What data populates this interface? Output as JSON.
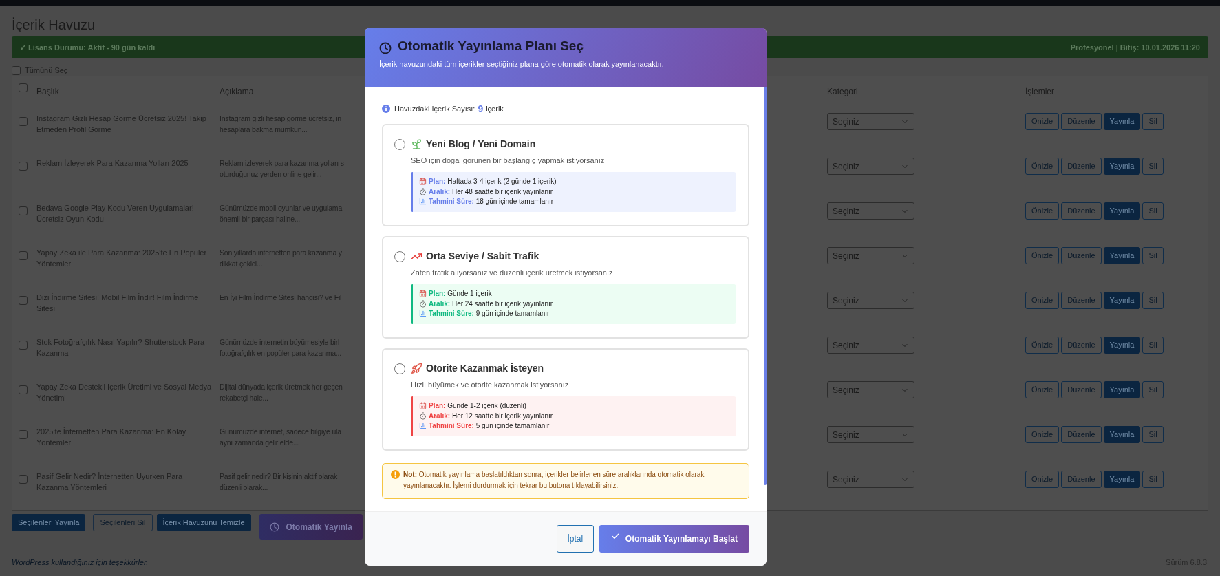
{
  "page": {
    "title": "İçerik Havuzu",
    "license": {
      "status": "✓ Lisans Durumu: Aktif - 90 gün kaldı",
      "plan": "Profesyonel | Bitiş: 10.01.2026 11:20"
    },
    "select_all": {
      "label": "Tümünü Seç",
      "checked": false
    },
    "table": {
      "columns": [
        "Başlık",
        "Açıklama",
        "Kategori",
        "İşlemler"
      ],
      "header_checked": false,
      "rows": [
        {
          "checked": false,
          "title": "Instagram Gizli Hesap Görme Ücretsiz 2025! Takip Etmeden Profil Görme",
          "description_lines": [
            "Instagram gizli hesap görme ücretsiz, in",
            "hesaplara bakma mümkün..."
          ],
          "category": "Seçiniz",
          "actions": [
            {
              "label": "Önizle",
              "kind": "outline"
            },
            {
              "label": "Düzenle",
              "kind": "outline"
            },
            {
              "label": "Yayınla",
              "kind": "primary"
            },
            {
              "label": "Sil",
              "kind": "outline"
            }
          ]
        },
        {
          "checked": false,
          "title": "Reklam İzleyerek Para Kazanma Yolları 2025",
          "description_lines": [
            "Reklam izleyerek para kazanma yolları s",
            "oturduğunuz yerden online gelir..."
          ],
          "category": "Seçiniz",
          "actions": [
            {
              "label": "Önizle",
              "kind": "outline"
            },
            {
              "label": "Düzenle",
              "kind": "outline"
            },
            {
              "label": "Yayınla",
              "kind": "primary"
            },
            {
              "label": "Sil",
              "kind": "outline"
            }
          ]
        },
        {
          "checked": false,
          "title": "Bedava Google Play Kodu Veren Uygulamalar! Ücretsiz Oyun Kodu",
          "description_lines": [
            "Günümüzde mobil oyunlar ve uygulama",
            "önemli bir parçası haline..."
          ],
          "category": "Seçiniz",
          "actions": [
            {
              "label": "Önizle",
              "kind": "outline"
            },
            {
              "label": "Düzenle",
              "kind": "outline"
            },
            {
              "label": "Yayınla",
              "kind": "primary"
            },
            {
              "label": "Sil",
              "kind": "outline"
            }
          ]
        },
        {
          "checked": false,
          "title": "Yapay Zeka ile Para Kazanma: 2025'te En Popüler Yöntemler",
          "description_lines": [
            "Son yıllarda internetten para kazanma y",
            "dikkat çekici..."
          ],
          "category": "Seçiniz",
          "actions": [
            {
              "label": "Önizle",
              "kind": "outline"
            },
            {
              "label": "Düzenle",
              "kind": "outline"
            },
            {
              "label": "Yayınla",
              "kind": "primary"
            },
            {
              "label": "Sil",
              "kind": "outline"
            }
          ]
        },
        {
          "checked": false,
          "title": "Dizi İndirme Sitesi! Mobil Film İndir! Film İndirme Sitesi",
          "description_lines": [
            "En İyi Film İndirme Sitesi hangisi? ve Fil"
          ],
          "category": "Seçiniz",
          "actions": [
            {
              "label": "Önizle",
              "kind": "outline"
            },
            {
              "label": "Düzenle",
              "kind": "outline"
            },
            {
              "label": "Yayınla",
              "kind": "primary"
            },
            {
              "label": "Sil",
              "kind": "outline"
            }
          ]
        },
        {
          "checked": false,
          "title": "Stok Fotoğrafçılık Nasıl Yapılır? Shutterstock Para Kazanma",
          "description_lines": [
            "Günümüzde internetin büyümesiyle birl",
            "fotoğrafçılık en popüler para kazanma..."
          ],
          "category": "Seçiniz",
          "actions": [
            {
              "label": "Önizle",
              "kind": "outline"
            },
            {
              "label": "Düzenle",
              "kind": "outline"
            },
            {
              "label": "Yayınla",
              "kind": "primary"
            },
            {
              "label": "Sil",
              "kind": "outline"
            }
          ]
        },
        {
          "checked": false,
          "title": "Yapay Zeka Destekli İçerik Üretimi ve Sosyal Medya Yönetimi",
          "description_lines": [
            "Dijital dünyada içerik üretmek her geçen",
            "rekabetçi hale..."
          ],
          "category": "Seçiniz",
          "actions": [
            {
              "label": "Önizle",
              "kind": "outline"
            },
            {
              "label": "Düzenle",
              "kind": "outline"
            },
            {
              "label": "Yayınla",
              "kind": "primary"
            },
            {
              "label": "Sil",
              "kind": "outline"
            }
          ]
        },
        {
          "checked": false,
          "title": "2025'te İnternetten Para Kazanma: En Kolay Yöntemler",
          "description_lines": [
            "Günümüzde internet, sadece bilgiye ula",
            "aynı zamanda gelir elde..."
          ],
          "category": "Seçiniz",
          "actions": [
            {
              "label": "Önizle",
              "kind": "outline"
            },
            {
              "label": "Düzenle",
              "kind": "outline"
            },
            {
              "label": "Yayınla",
              "kind": "primary"
            },
            {
              "label": "Sil",
              "kind": "outline"
            }
          ]
        },
        {
          "checked": false,
          "title": "Pasif Gelir Nedir? İnternetten Uyurken Para Kazanma Yöntemleri",
          "description_lines": [
            "Pasif gelir nedir? Bir kişinin aktif olarak",
            "düzenli olarak..."
          ],
          "category": "Seçiniz",
          "actions": [
            {
              "label": "Önizle",
              "kind": "outline"
            },
            {
              "label": "Düzenle",
              "kind": "outline"
            },
            {
              "label": "Yayınla",
              "kind": "primary"
            },
            {
              "label": "Sil",
              "kind": "outline"
            }
          ]
        }
      ]
    },
    "bulk_buttons": [
      {
        "label": "Seçilenleri Yayınla",
        "kind": "primary"
      },
      {
        "label": "Seçilenleri Sil",
        "kind": "outline"
      },
      {
        "label": "İçerik Havuzunu Temizle",
        "kind": "primary"
      },
      {
        "label": "Otomatik Yayınla",
        "kind": "auto"
      }
    ],
    "footer": {
      "thanks": "WordPress kullandığınız için teşekkürler.",
      "version": "Sürüm 6.8.3"
    }
  },
  "modal": {
    "title": "Otomatik Yayınlama Planı Seç",
    "subtitle": "İçerik havuzundaki tüm içerikler seçtiğiniz plana göre otomatik olarak yayınlanacaktır.",
    "pool_count": {
      "label": "Havuzdaki İçerik Sayısı:",
      "value": "9",
      "unit": "içerik"
    },
    "plans": [
      {
        "kind": "blog",
        "selected": false,
        "color": "#667eea",
        "title": "Yeni Blog / Yeni Domain",
        "description": "SEO için doğal görünen bir başlangıç yapmak istiyorsanız",
        "details": [
          {
            "kind": "plan",
            "label": "Plan:",
            "value": "Haftada 3-4 içerik (2 günde 1 içerik)"
          },
          {
            "kind": "interval",
            "label": "Aralık:",
            "value": "Her 48 saatte bir içerik yayınlanır"
          },
          {
            "kind": "duration",
            "label": "Tahmini Süre:",
            "value": "18 gün içinde tamamlanır"
          }
        ]
      },
      {
        "kind": "traffic",
        "selected": false,
        "color": "#10b981",
        "title": "Orta Seviye / Sabit Trafik",
        "description": "Zaten trafik alıyorsanız ve düzenli içerik üretmek istiyorsanız",
        "details": [
          {
            "kind": "plan",
            "label": "Plan:",
            "value": "Günde 1 içerik"
          },
          {
            "kind": "interval",
            "label": "Aralık:",
            "value": "Her 24 saatte bir içerik yayınlanır"
          },
          {
            "kind": "duration",
            "label": "Tahmini Süre:",
            "value": "9 gün içinde tamamlanır"
          }
        ]
      },
      {
        "kind": "authority",
        "selected": false,
        "color": "#ef4444",
        "title": "Otorite Kazanmak İsteyen",
        "description": "Hızlı büyümek ve otorite kazanmak istiyorsanız",
        "details": [
          {
            "kind": "plan",
            "label": "Plan:",
            "value": "Günde 1-2 içerik (düzenli)"
          },
          {
            "kind": "interval",
            "label": "Aralık:",
            "value": "Her 12 saatte bir içerik yayınlanır"
          },
          {
            "kind": "duration",
            "label": "Tahmini Süre:",
            "value": "5 gün içinde tamamlanır"
          }
        ]
      }
    ],
    "note": "**Not:** Otomatik yayınlama başlatıldıktan sonra, içerikler belirlenen süre aralıklarında otomatik olarak yayınlanacaktır. İşlemi durdurmak için tekrar bu butona tıklayabilirsiniz.",
    "buttons": [
      {
        "label": "İptal",
        "kind": "secondary"
      },
      {
        "label": "Otomatik Yayınlamayı Başlat",
        "kind": "primary"
      }
    ]
  }
}
